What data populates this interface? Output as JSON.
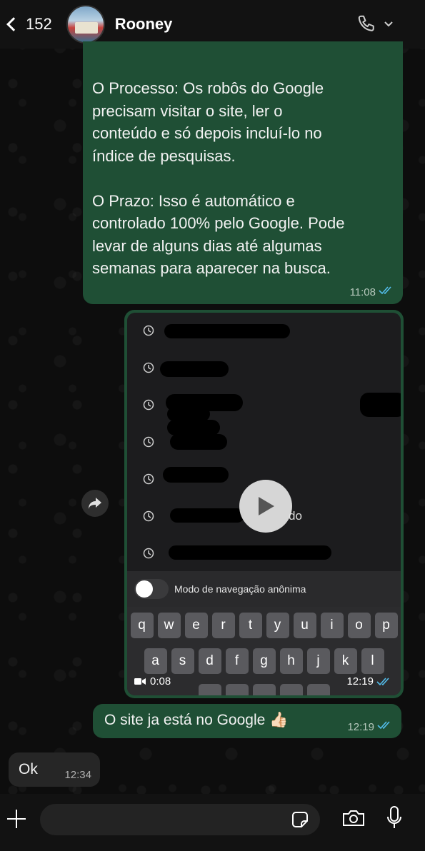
{
  "header": {
    "back_count": "152",
    "contact_name": "Rooney"
  },
  "messages": {
    "out1": {
      "text": "O Processo: Os robôs do Google\nprecisam visitar o site, ler o\nconteúdo e só depois incluí-lo no\níndice de pesquisas.\n\nO Prazo: Isso é automático e\ncontrolado 100% pelo Google. Pode\nlevar de alguns dias até algumas\nsemanas para aparecer na busca.",
      "time": "11:08"
    },
    "video": {
      "duration": "0:08",
      "time": "12:19",
      "incognito_label": "Modo de navegação anônima",
      "keyboard_row1": [
        "q",
        "w",
        "e",
        "r",
        "t",
        "y",
        "u",
        "i",
        "o",
        "p"
      ],
      "keyboard_row2": [
        "a",
        "s",
        "d",
        "f",
        "g",
        "h",
        "j",
        "k",
        "l"
      ],
      "partial_text": [
        "do"
      ]
    },
    "out2": {
      "text": "O site ja está no Google 👍🏻",
      "time": "12:19"
    },
    "in1": {
      "text": "Ok",
      "time": "12:34"
    }
  },
  "colors": {
    "outgoing_bubble": "#1f4f35",
    "incoming_bubble": "#262626",
    "read_tick": "#53bdeb"
  },
  "icons": {
    "back": "chevron-left-icon",
    "call": "phone-icon",
    "forward": "forward-arrow-icon",
    "play": "play-icon",
    "attach": "plus-icon",
    "sticker": "sticker-icon",
    "camera": "camera-icon",
    "mic": "microphone-icon"
  }
}
